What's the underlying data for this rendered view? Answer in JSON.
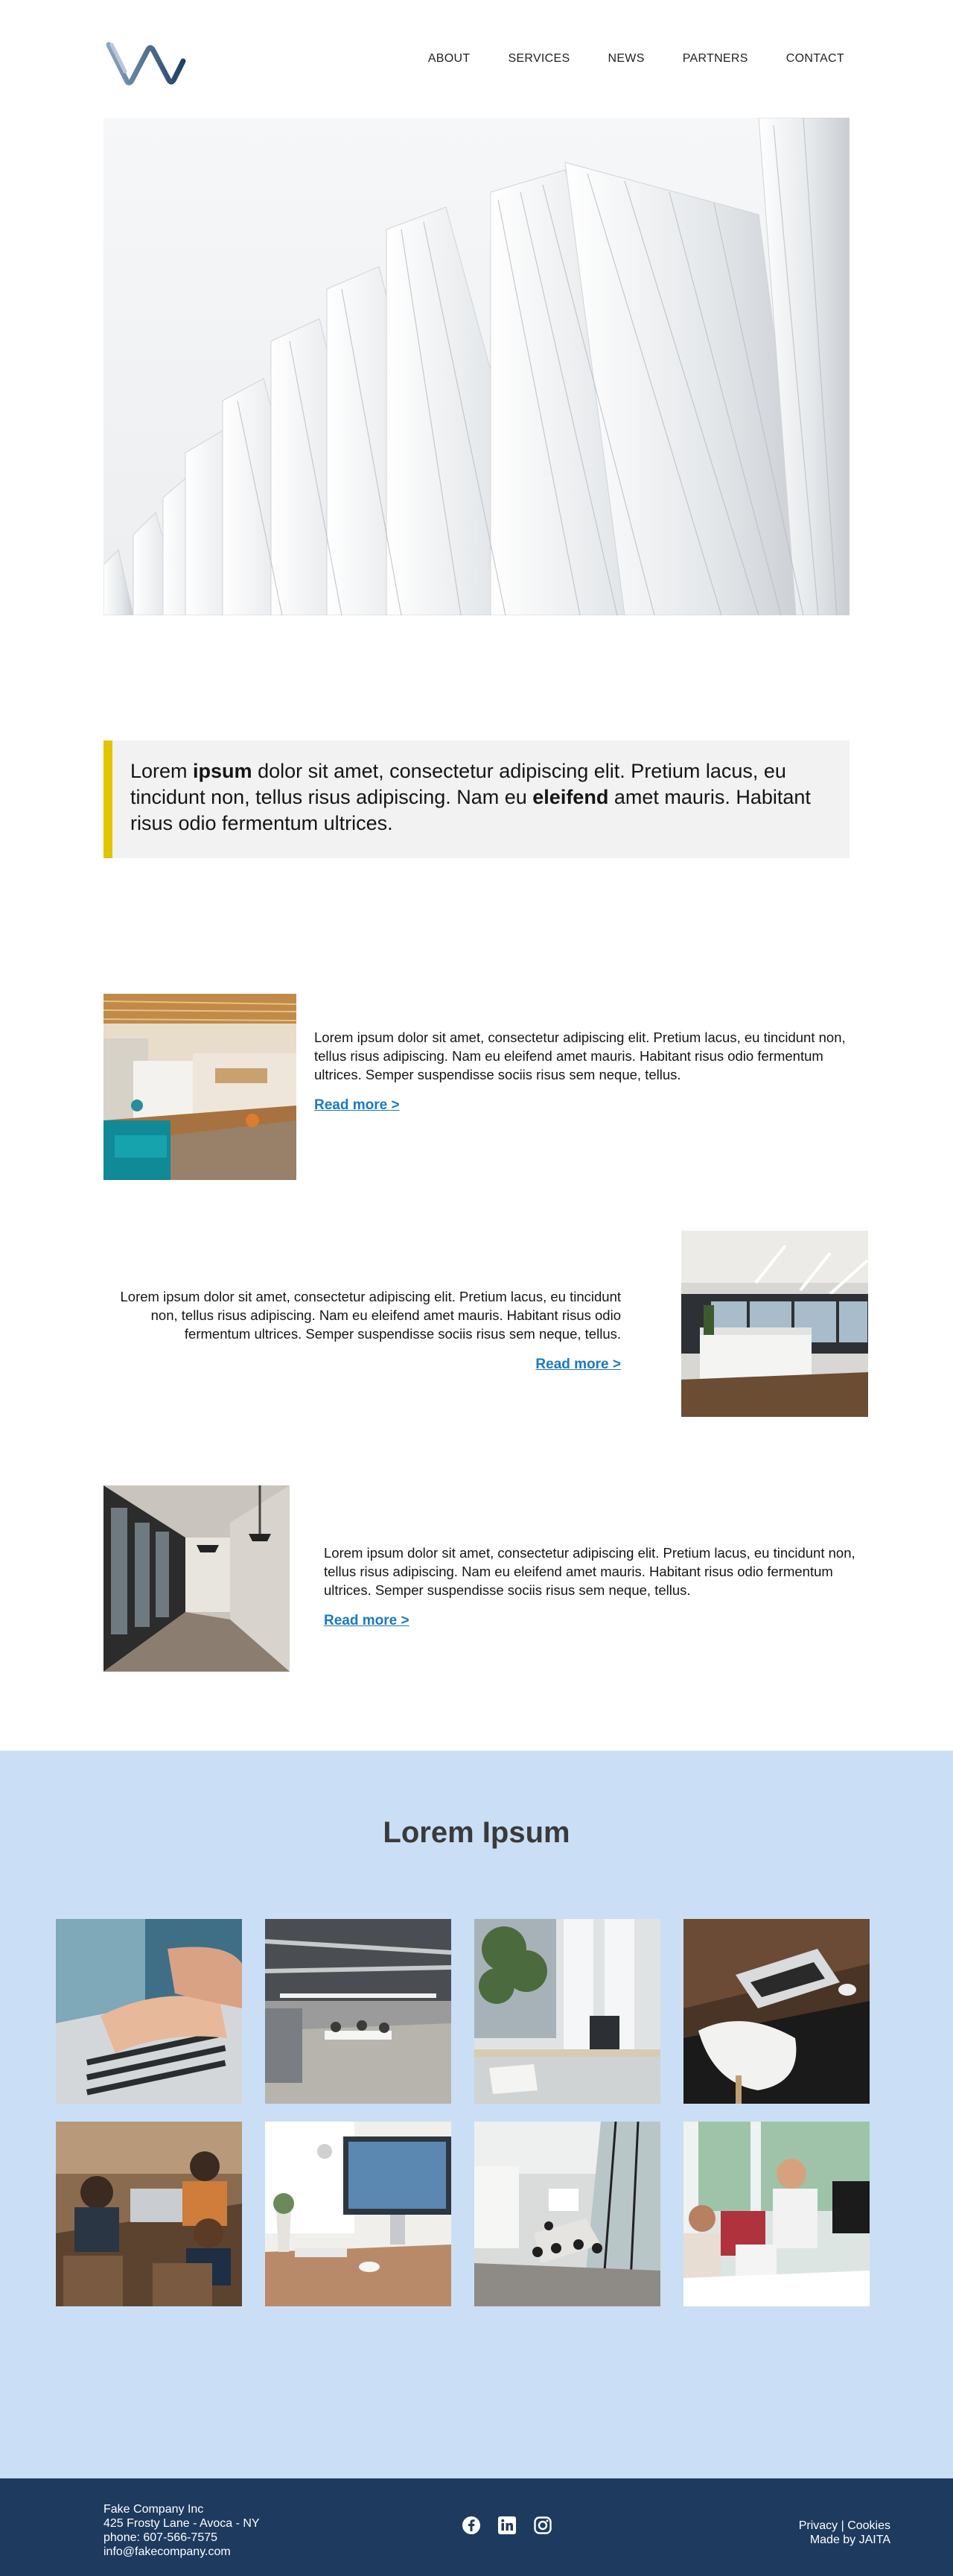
{
  "nav": {
    "items": [
      "ABOUT",
      "SERVICES",
      "NEWS",
      "PARTNERS",
      "CONTACT"
    ]
  },
  "quote": {
    "p1": "Lorem ",
    "b1": "ipsum",
    "p2": " dolor sit amet, consectetur adipiscing elit. Pretium lacus, eu tincidunt non, tellus risus adipiscing. Nam eu ",
    "b2": "eleifend",
    "p3": " amet mauris. Habitant risus odio fermentum ultrices."
  },
  "features": [
    {
      "text": "Lorem ipsum dolor sit amet, consectetur adipiscing elit. Pretium lacus, eu tincidunt non, tellus risus adipiscing. Nam eu eleifend amet mauris. Habitant risus odio fermentum ultrices. Semper suspendisse sociis risus sem neque, tellus.",
      "link": "Read more >"
    },
    {
      "text": "Lorem ipsum dolor sit amet, consectetur adipiscing elit. Pretium lacus, eu tincidunt non, tellus risus adipiscing. Nam eu eleifend amet mauris. Habitant risus odio fermentum ultrices. Semper suspendisse sociis risus sem neque, tellus.",
      "link": "Read more >"
    },
    {
      "text": "Lorem ipsum dolor sit amet, consectetur adipiscing elit. Pretium lacus, eu tincidunt non, tellus risus adipiscing. Nam eu eleifend amet mauris. Habitant risus odio fermentum ultrices. Semper suspendisse sociis risus sem neque, tellus.",
      "link": "Read more >"
    }
  ],
  "gallery": {
    "title": "Lorem Ipsum"
  },
  "footer": {
    "company": "Fake Company Inc",
    "address": "425 Frosty Lane - Avoca - NY",
    "phone": "phone: 607-566-7575",
    "email": "info@fakecompany.com",
    "privacy": "Privacy",
    "separator": " | ",
    "cookies": "Cookies",
    "credit": "Made by JAITA",
    "social_icons": [
      "facebook-icon",
      "linkedin-icon",
      "instagram-icon"
    ]
  },
  "colors": {
    "accent_yellow": "#e2c400",
    "link_blue": "#1a7ac0",
    "gallery_bg": "#cadff5",
    "footer_bg": "#1e3a5f"
  }
}
